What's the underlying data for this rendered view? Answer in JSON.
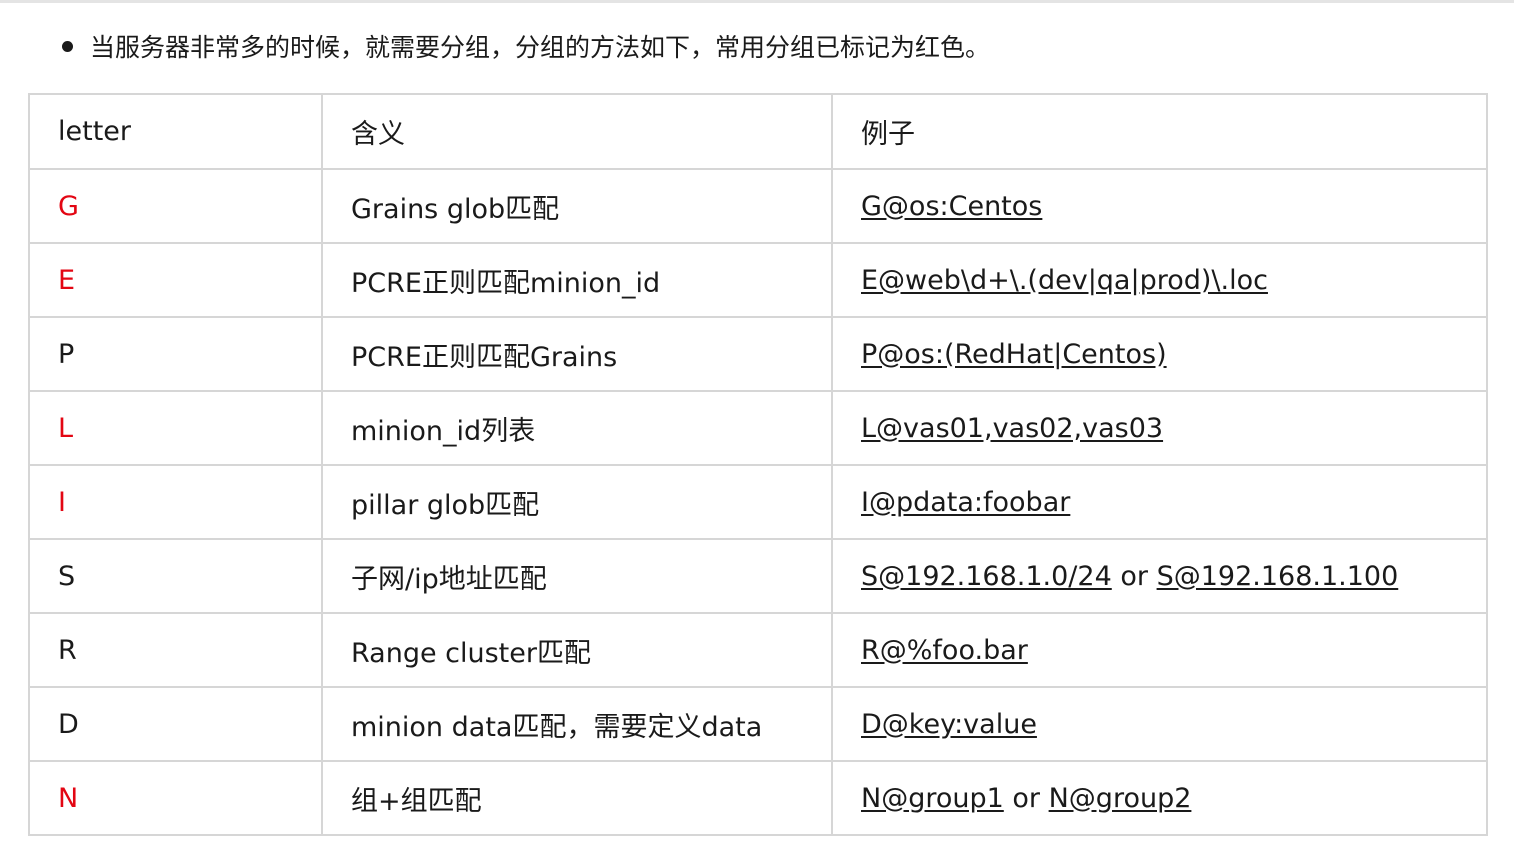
{
  "intro": {
    "text": "当服务器非常多的时候，就需要分组，分组的方法如下，常用分组已标记为红色。"
  },
  "colors": {
    "highlight": "#e30613",
    "text": "#1a1a1a",
    "border": "#d6d6d6"
  },
  "table": {
    "headers": [
      "letter",
      "含义",
      "例子"
    ],
    "rows": [
      {
        "letter": "G",
        "red": true,
        "meaning": "Grains glob匹配",
        "examples": [
          "G@os:Centos"
        ]
      },
      {
        "letter": "E",
        "red": true,
        "meaning": "PCRE正则匹配minion_id",
        "examples": [
          "E@web\\d+\\.(dev|qa|prod)\\.loc"
        ]
      },
      {
        "letter": "P",
        "red": false,
        "meaning": "PCRE正则匹配Grains",
        "examples": [
          "P@os:(RedHat|Centos)"
        ]
      },
      {
        "letter": "L",
        "red": true,
        "meaning": "minion_id列表",
        "examples": [
          "L@vas01,vas02,vas03"
        ]
      },
      {
        "letter": "I",
        "red": true,
        "meaning": "pillar glob匹配",
        "examples": [
          "I@pdata:foobar"
        ]
      },
      {
        "letter": "S",
        "red": false,
        "meaning": "子网/ip地址匹配",
        "examples": [
          "S@192.168.1.0/24",
          "S@192.168.1.100"
        ],
        "separator": "or"
      },
      {
        "letter": "R",
        "red": false,
        "meaning": "Range cluster匹配",
        "examples": [
          "R@%foo.bar"
        ]
      },
      {
        "letter": "D",
        "red": false,
        "meaning": "minion data匹配，需要定义data",
        "examples": [
          "D@key:value"
        ]
      },
      {
        "letter": "N",
        "red": true,
        "meaning": "组+组匹配",
        "examples": [
          "N@group1",
          "N@group2"
        ],
        "separator": "or"
      }
    ]
  }
}
